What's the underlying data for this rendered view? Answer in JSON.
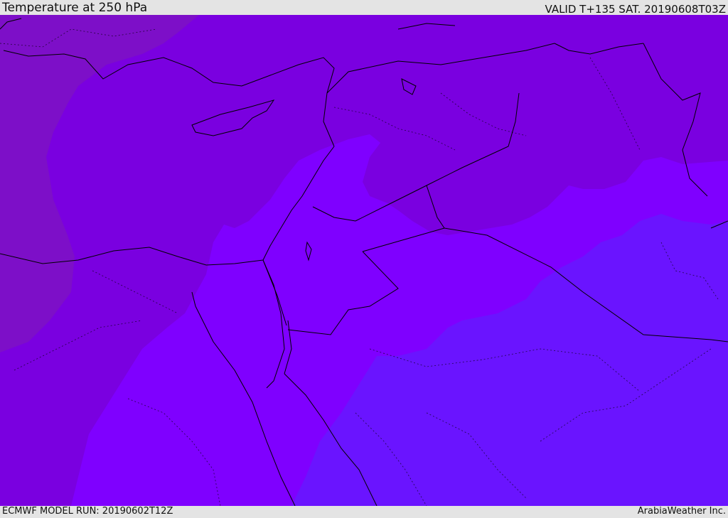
{
  "header": {
    "title": "Temperature at 250 hPa",
    "valid": "VALID T+135 SAT. 20190608T03Z"
  },
  "footer": {
    "model_run": "ECMWF MODEL RUN: 20190602T12Z",
    "credit": "ArabiaWeather Inc."
  },
  "map": {
    "colors": {
      "band_west": "#7d0fc8",
      "band_main": "#7a00e0",
      "band_mid": "#7f00ff",
      "band_east": "#6a14ff",
      "coast_line": "#000000"
    }
  }
}
